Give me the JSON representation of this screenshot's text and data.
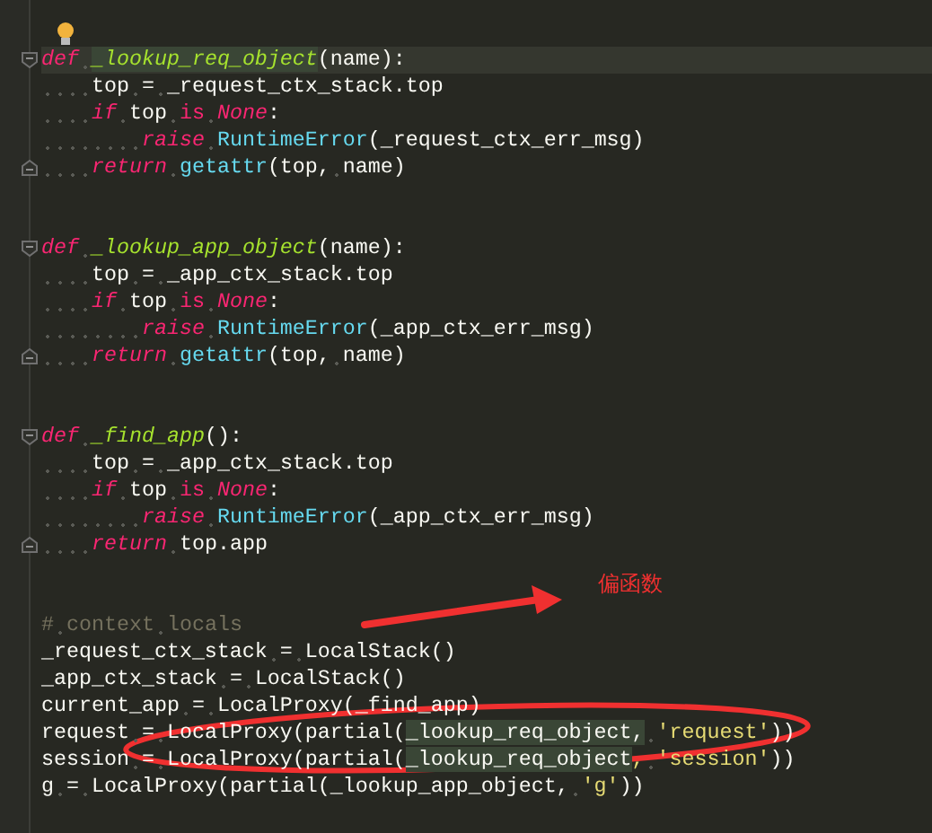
{
  "editor": {
    "lines": [
      {
        "collapsible": true,
        "block_end": false,
        "current": true,
        "tokens": [
          {
            "kind": "kw",
            "text": "def "
          },
          {
            "kind": "fn",
            "text": "_lookup_req_object",
            "highlighted": true
          },
          {
            "kind": "tx",
            "text": "(name):"
          }
        ]
      },
      {
        "collapsible": false,
        "block_end": false,
        "current": false,
        "tokens": [
          {
            "kind": "tx",
            "text": "    top = _request_ctx_stack.top"
          }
        ]
      },
      {
        "collapsible": false,
        "block_end": false,
        "current": false,
        "tokens": [
          {
            "kind": "kw",
            "text": "    if"
          },
          {
            "kind": "tx",
            "text": " top "
          },
          {
            "kind": "op",
            "text": "is "
          },
          {
            "kind": "kw",
            "text": "None"
          },
          {
            "kind": "tx",
            "text": ":"
          }
        ]
      },
      {
        "collapsible": false,
        "block_end": false,
        "current": false,
        "tokens": [
          {
            "kind": "kw",
            "text": "        raise "
          },
          {
            "kind": "bi",
            "text": "RuntimeError"
          },
          {
            "kind": "tx",
            "text": "(_request_ctx_err_msg)"
          }
        ]
      },
      {
        "collapsible": false,
        "block_end": true,
        "current": false,
        "tokens": [
          {
            "kind": "kw",
            "text": "    return "
          },
          {
            "kind": "bi",
            "text": "getattr"
          },
          {
            "kind": "tx",
            "text": "(top, name)"
          }
        ]
      },
      {
        "collapsible": false,
        "block_end": false,
        "current": false
      },
      {
        "collapsible": false,
        "block_end": false,
        "current": false
      },
      {
        "collapsible": true,
        "block_end": false,
        "current": false,
        "tokens": [
          {
            "kind": "kw",
            "text": "def "
          },
          {
            "kind": "fn",
            "text": "_lookup_app_object"
          },
          {
            "kind": "tx",
            "text": "(name):"
          }
        ]
      },
      {
        "collapsible": false,
        "block_end": false,
        "current": false,
        "tokens": [
          {
            "kind": "tx",
            "text": "    top = _app_ctx_stack.top"
          }
        ]
      },
      {
        "collapsible": false,
        "block_end": false,
        "current": false,
        "tokens": [
          {
            "kind": "kw",
            "text": "    if"
          },
          {
            "kind": "tx",
            "text": " top "
          },
          {
            "kind": "op",
            "text": "is "
          },
          {
            "kind": "kw",
            "text": "None"
          },
          {
            "kind": "tx",
            "text": ":"
          }
        ]
      },
      {
        "collapsible": false,
        "block_end": false,
        "current": false,
        "tokens": [
          {
            "kind": "kw",
            "text": "        raise "
          },
          {
            "kind": "bi",
            "text": "RuntimeError"
          },
          {
            "kind": "tx",
            "text": "(_app_ctx_err_msg)"
          }
        ]
      },
      {
        "collapsible": false,
        "block_end": true,
        "current": false,
        "tokens": [
          {
            "kind": "kw",
            "text": "    return "
          },
          {
            "kind": "bi",
            "text": "getattr"
          },
          {
            "kind": "tx",
            "text": "(top, name)"
          }
        ]
      },
      {
        "collapsible": false,
        "block_end": false,
        "current": false
      },
      {
        "collapsible": false,
        "block_end": false,
        "current": false
      },
      {
        "collapsible": true,
        "block_end": false,
        "current": false,
        "tokens": [
          {
            "kind": "kw",
            "text": "def "
          },
          {
            "kind": "fn",
            "text": "_find_app"
          },
          {
            "kind": "tx",
            "text": "():"
          }
        ]
      },
      {
        "collapsible": false,
        "block_end": false,
        "current": false,
        "tokens": [
          {
            "kind": "tx",
            "text": "    top = _app_ctx_stack.top"
          }
        ]
      },
      {
        "collapsible": false,
        "block_end": false,
        "current": false,
        "tokens": [
          {
            "kind": "kw",
            "text": "    if"
          },
          {
            "kind": "tx",
            "text": " top "
          },
          {
            "kind": "op",
            "text": "is "
          },
          {
            "kind": "kw",
            "text": "None"
          },
          {
            "kind": "tx",
            "text": ":"
          }
        ]
      },
      {
        "collapsible": false,
        "block_end": false,
        "current": false,
        "tokens": [
          {
            "kind": "kw",
            "text": "        raise "
          },
          {
            "kind": "bi",
            "text": "RuntimeError"
          },
          {
            "kind": "tx",
            "text": "(_app_ctx_err_msg)"
          }
        ]
      },
      {
        "collapsible": false,
        "block_end": true,
        "current": false,
        "tokens": [
          {
            "kind": "kw",
            "text": "    return "
          },
          {
            "kind": "tx",
            "text": "top.app"
          }
        ]
      },
      {
        "collapsible": false,
        "block_end": false,
        "current": false
      },
      {
        "collapsible": false,
        "block_end": false,
        "current": false
      },
      {
        "collapsible": false,
        "block_end": false,
        "current": false,
        "tokens": [
          {
            "kind": "cm",
            "text": "# context locals"
          }
        ]
      },
      {
        "collapsible": false,
        "block_end": false,
        "current": false,
        "tokens": [
          {
            "kind": "tx",
            "text": "_request_ctx_stack = LocalStack()"
          }
        ]
      },
      {
        "collapsible": false,
        "block_end": false,
        "current": false,
        "tokens": [
          {
            "kind": "tx",
            "text": "_app_ctx_stack = LocalStack()"
          }
        ]
      },
      {
        "collapsible": false,
        "block_end": false,
        "current": false,
        "tokens": [
          {
            "kind": "tx",
            "text": "current_app = LocalProxy(_find_app)"
          }
        ]
      },
      {
        "collapsible": false,
        "block_end": false,
        "current": false,
        "tokens": [
          {
            "kind": "tx",
            "text": "request = LocalProxy(partial("
          },
          {
            "kind": "tx",
            "text": "_lookup_req_object,",
            "highlighted": true
          },
          {
            "kind": "st",
            "text": " 'request'"
          },
          {
            "kind": "tx",
            "text": "))"
          }
        ]
      },
      {
        "collapsible": false,
        "block_end": false,
        "current": false,
        "tokens": [
          {
            "kind": "tx",
            "text": "session = LocalProxy(partial("
          },
          {
            "kind": "tx",
            "text": "_lookup_req_object",
            "highlighted": true
          },
          {
            "kind": "st",
            "text": ", 'session'"
          },
          {
            "kind": "tx",
            "text": "))"
          }
        ]
      },
      {
        "collapsible": false,
        "block_end": false,
        "current": false,
        "tokens": [
          {
            "kind": "tx",
            "text": "g = LocalProxy(partial(_lookup_app_object, "
          },
          {
            "kind": "st",
            "text": "'g'"
          },
          {
            "kind": "tx",
            "text": "))"
          }
        ]
      }
    ]
  },
  "annotation": {
    "label": "偏函数"
  }
}
